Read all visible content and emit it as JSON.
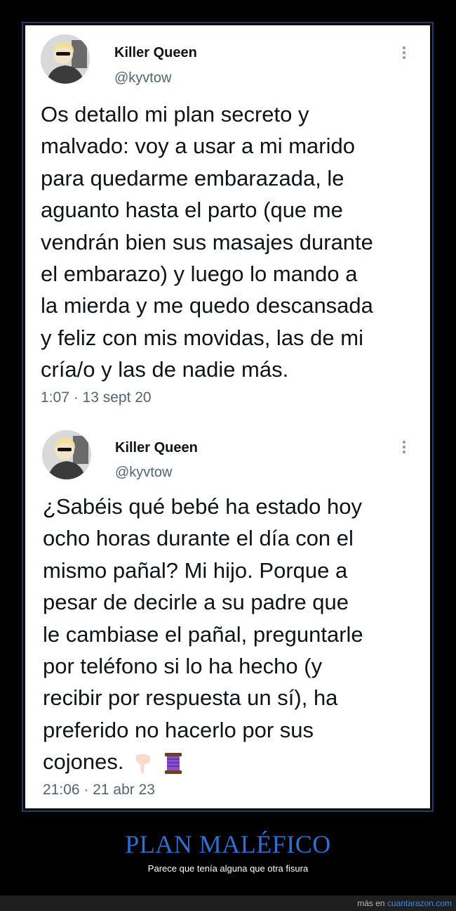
{
  "tweets": [
    {
      "name": "Killer Queen",
      "handle": "@kyvtow",
      "lines": [
        "Os detallo mi plan secreto y",
        "malvado: voy a usar a mi marido",
        "para quedarme embarazada, le",
        "aguanto hasta el parto (que me",
        "vendrán bien sus masajes durante",
        "el embarazo) y luego lo mando a",
        "la mierda y me quedo descansada",
        "y feliz con mis movidas, las de mi",
        "cría/o y las de nadie más."
      ],
      "timestamp": "1:07 · 13 sept 20"
    },
    {
      "name": "Killer Queen",
      "handle": "@kyvtow",
      "lines": [
        "¿Sabéis qué bebé ha estado hoy",
        "ocho horas durante el día con el",
        "mismo pañal? Mi hijo. Porque a",
        "pesar de decirle a su padre que",
        "le cambiase el pañal, preguntarle",
        "por teléfono si lo ha hecho (y",
        "recibir por respuesta un sí), ha",
        "preferido no hacerlo por sus",
        "cojones."
      ],
      "emojis": [
        "pointing-down-hand-icon",
        "thread-spool-icon"
      ],
      "timestamp": "21:06 · 21 abr 23"
    }
  ],
  "caption": {
    "title": "PLAN MALÉFICO",
    "subtitle": "Parece que tenía alguna que otra fisura"
  },
  "footer": {
    "prefix": "más en",
    "link": "cuantarazon.com"
  },
  "colors": {
    "accent": "#2f6fd0",
    "frame": "#2a3a66",
    "meta_gray": "#536471"
  }
}
